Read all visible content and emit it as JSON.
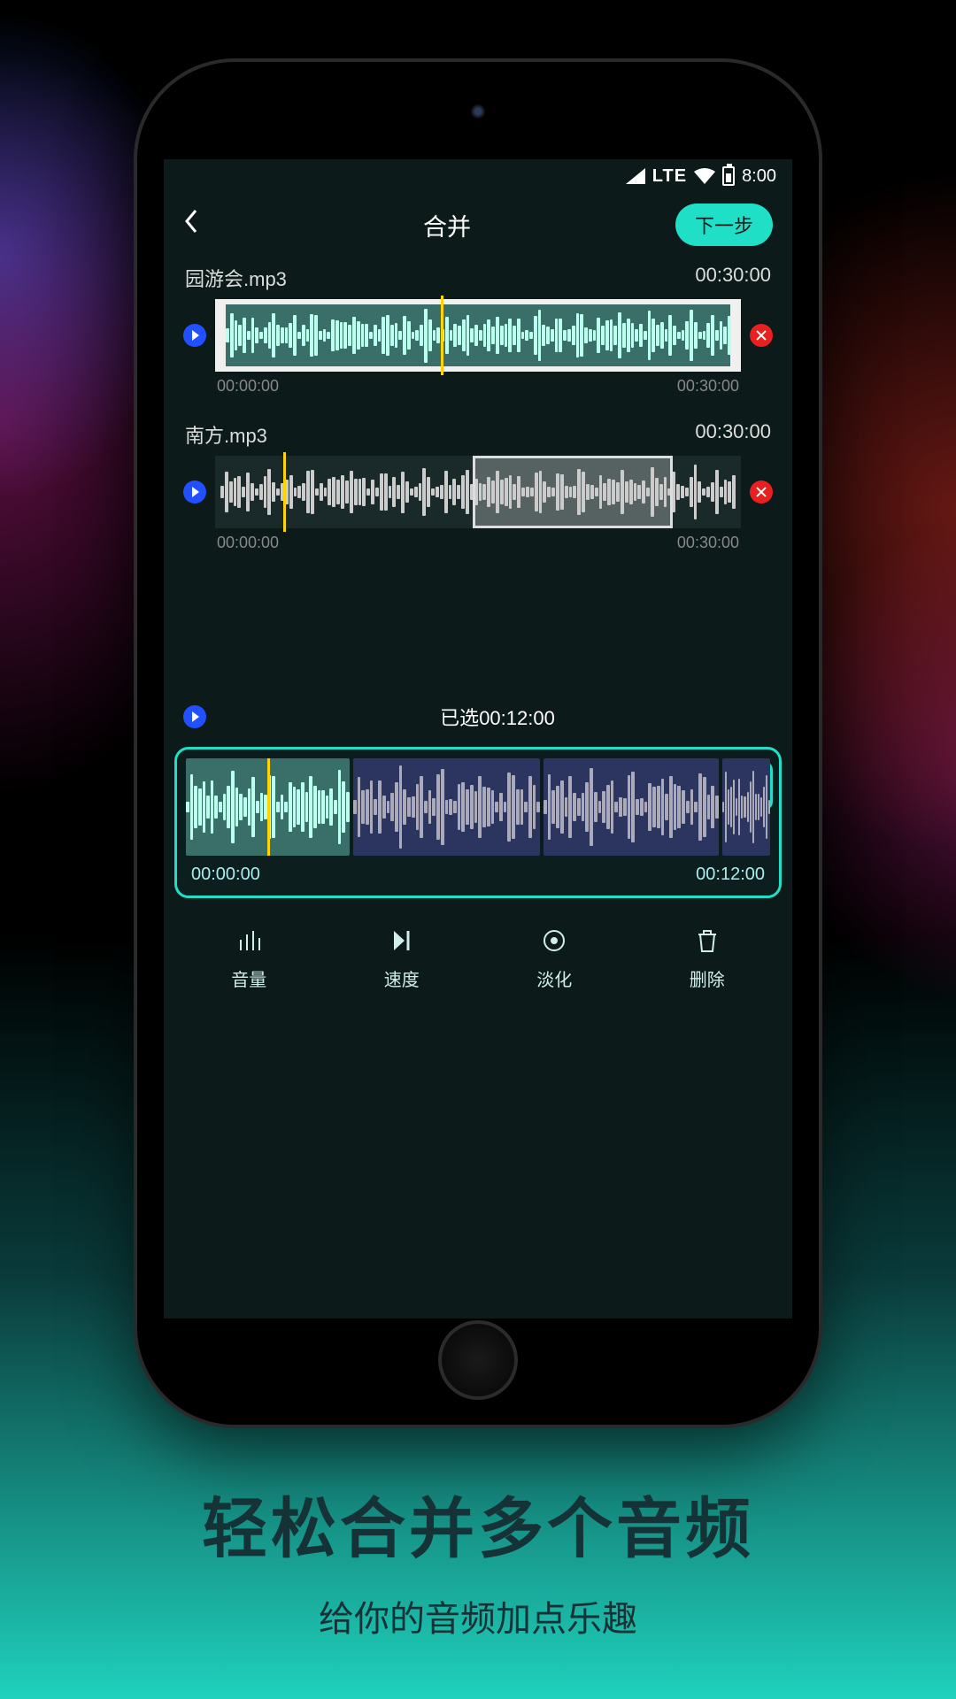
{
  "status": {
    "net": "LTE",
    "time": "8:00"
  },
  "appbar": {
    "title": "合并",
    "next": "下一步"
  },
  "tracks": [
    {
      "name": "园游会.mp3",
      "dur": "00:30:00",
      "start": "00:00:00",
      "end": "00:30:00"
    },
    {
      "name": "南方.mp3",
      "dur": "00:30:00",
      "start": "00:00:00",
      "end": "00:30:00"
    }
  ],
  "selected": {
    "label_prefix": "已选",
    "time": "00:12:00"
  },
  "combo": {
    "start": "00:00:00",
    "end": "00:12:00"
  },
  "tools": {
    "vol": "音量",
    "spd": "速度",
    "fade": "淡化",
    "del": "删除"
  },
  "promo": {
    "h": "轻松合并多个音频",
    "s": "给你的音频加点乐趣"
  },
  "colors": {
    "accent": "#1fe0c6"
  }
}
